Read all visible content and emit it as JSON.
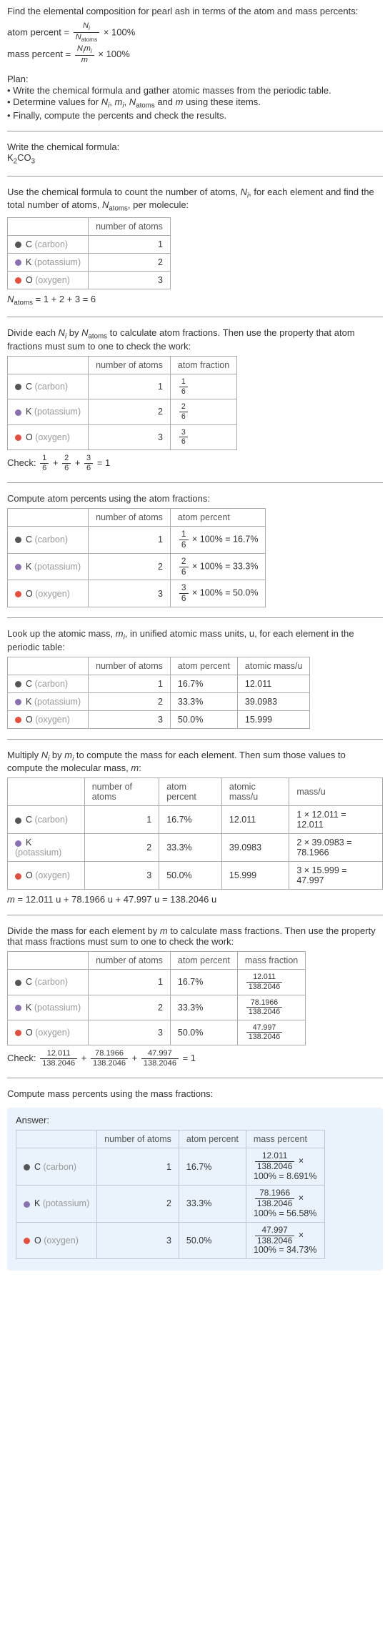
{
  "intro": {
    "prompt": "Find the elemental composition for pearl ash in terms of the atom and mass percents:",
    "atom_percent_lhs": "atom percent =",
    "atom_percent_num": "N",
    "atom_percent_num_sub": "i",
    "atom_percent_den": "N",
    "atom_percent_den_sub": "atoms",
    "times100": "× 100%",
    "mass_percent_lhs": "mass percent =",
    "mass_percent_num1": "N",
    "mass_percent_num1_sub": "i",
    "mass_percent_num2": "m",
    "mass_percent_num2_sub": "i",
    "mass_percent_den": "m"
  },
  "plan": {
    "title": "Plan:",
    "line1": "• Write the chemical formula and gather atomic masses from the periodic table.",
    "line2_a": "• Determine values for ",
    "line2_ni": "N",
    "line2_ni_sub": "i",
    "line2_c1": ", ",
    "line2_mi": "m",
    "line2_mi_sub": "i",
    "line2_c2": ", ",
    "line2_na": "N",
    "line2_na_sub": "atoms",
    "line2_c3": " and ",
    "line2_m": "m",
    "line2_end": " using these items.",
    "line3": "• Finally, compute the percents and check the results."
  },
  "step1": {
    "title": "Write the chemical formula:",
    "formula_k": "K",
    "formula_k_sub": "2",
    "formula_co": "CO",
    "formula_co_sub": "3"
  },
  "step2": {
    "title_a": "Use the chemical formula to count the number of atoms, ",
    "title_ni": "N",
    "title_ni_sub": "i",
    "title_b": ", for each element and find the total number of atoms, ",
    "title_na": "N",
    "title_na_sub": "atoms",
    "title_c": ", per molecule:",
    "col_atoms": "number of atoms",
    "sum_lhs": "N",
    "sum_sub": "atoms",
    "sum_rhs": " = 1 + 2 + 3 = 6"
  },
  "elements": {
    "c_sym": "C",
    "c_name": "(carbon)",
    "k_sym": "K",
    "k_name": "(potassium)",
    "o_sym": "O",
    "o_name": "(oxygen)"
  },
  "step3": {
    "title_a": "Divide each ",
    "title_b": " by ",
    "title_c": " to calculate atom fractions. Then use the property that atom fractions must sum to one to check the work:",
    "col_frac": "atom fraction",
    "f_c_num": "1",
    "f_c_den": "6",
    "f_k_num": "2",
    "f_k_den": "6",
    "f_o_num": "3",
    "f_o_den": "6",
    "check_a": "Check: ",
    "check_eq": " = 1"
  },
  "step4": {
    "title": "Compute atom percents using the atom fractions:",
    "col_percent": "atom percent",
    "pc_c_num": "1",
    "pc_c_den": "6",
    "pc_c_rhs": " × 100% = 16.7%",
    "pc_k_num": "2",
    "pc_k_den": "6",
    "pc_k_rhs": " × 100% = 33.3%",
    "pc_o_num": "3",
    "pc_o_den": "6",
    "pc_o_rhs": " × 100% = 50.0%"
  },
  "step5": {
    "title_a": "Look up the atomic mass, ",
    "title_mi": "m",
    "title_mi_sub": "i",
    "title_b": ", in unified atomic mass units, u, for each element in the periodic table:",
    "col_mass": "atomic mass/u",
    "m_c": "12.011",
    "m_k": "39.0983",
    "m_o": "15.999"
  },
  "step6": {
    "title_a": "Multiply ",
    "title_b": " by ",
    "title_c": " to compute the mass for each element. Then sum those values to compute the molecular mass, ",
    "title_m": "m",
    "title_d": ":",
    "col_massu": "mass/u",
    "r_c": "1 × 12.011 = 12.011",
    "r_k": "2 × 39.0983 = 78.1966",
    "r_o": "3 × 15.999 = 47.997",
    "sum": " = 12.011 u + 78.1966 u + 47.997 u = 138.2046 u"
  },
  "step7": {
    "title_a": "Divide the mass for each element by ",
    "title_m": "m",
    "title_b": " to calculate mass fractions. Then use the property that mass fractions must sum to one to check the work:",
    "col_mfrac": "mass fraction",
    "mf_c_num": "12.011",
    "mf_c_den": "138.2046",
    "mf_k_num": "78.1966",
    "mf_k_den": "138.2046",
    "mf_o_num": "47.997",
    "mf_o_den": "138.2046",
    "check_a": "Check: ",
    "check_eq": " = 1",
    "plus": " + "
  },
  "step8": {
    "title": "Compute mass percents using the mass fractions:"
  },
  "answer": {
    "label": "Answer:",
    "col_mpercent": "mass percent",
    "mp_c_num": "12.011",
    "mp_c_den": "138.2046",
    "mp_c_rhs": "100% = 8.691%",
    "mp_k_num": "78.1966",
    "mp_k_den": "138.2046",
    "mp_k_rhs": "100% = 56.58%",
    "mp_o_num": "47.997",
    "mp_o_den": "138.2046",
    "mp_o_rhs": "100% = 34.73%",
    "times": " ×"
  },
  "counts": {
    "c": "1",
    "k": "2",
    "o": "3"
  },
  "percents": {
    "c": "16.7%",
    "k": "33.3%",
    "o": "50.0%"
  },
  "chart_data": [
    {
      "type": "table",
      "title": "number of atoms",
      "categories": [
        "C (carbon)",
        "K (potassium)",
        "O (oxygen)"
      ],
      "values": [
        1,
        2,
        3
      ]
    },
    {
      "type": "table",
      "title": "atom fraction",
      "categories": [
        "C",
        "K",
        "O"
      ],
      "values": [
        0.1667,
        0.3333,
        0.5
      ]
    },
    {
      "type": "table",
      "title": "atom percent",
      "categories": [
        "C",
        "K",
        "O"
      ],
      "values": [
        16.7,
        33.3,
        50.0
      ]
    },
    {
      "type": "table",
      "title": "atomic mass/u",
      "categories": [
        "C",
        "K",
        "O"
      ],
      "values": [
        12.011,
        39.0983,
        15.999
      ]
    },
    {
      "type": "table",
      "title": "mass/u",
      "categories": [
        "C",
        "K",
        "O"
      ],
      "values": [
        12.011,
        78.1966,
        47.997
      ],
      "total": 138.2046
    },
    {
      "type": "table",
      "title": "mass fraction",
      "categories": [
        "C",
        "K",
        "O"
      ],
      "values": [
        0.08691,
        0.5658,
        0.34729
      ]
    },
    {
      "type": "table",
      "title": "mass percent",
      "categories": [
        "C",
        "K",
        "O"
      ],
      "values": [
        8.691,
        56.58,
        34.73
      ]
    }
  ]
}
